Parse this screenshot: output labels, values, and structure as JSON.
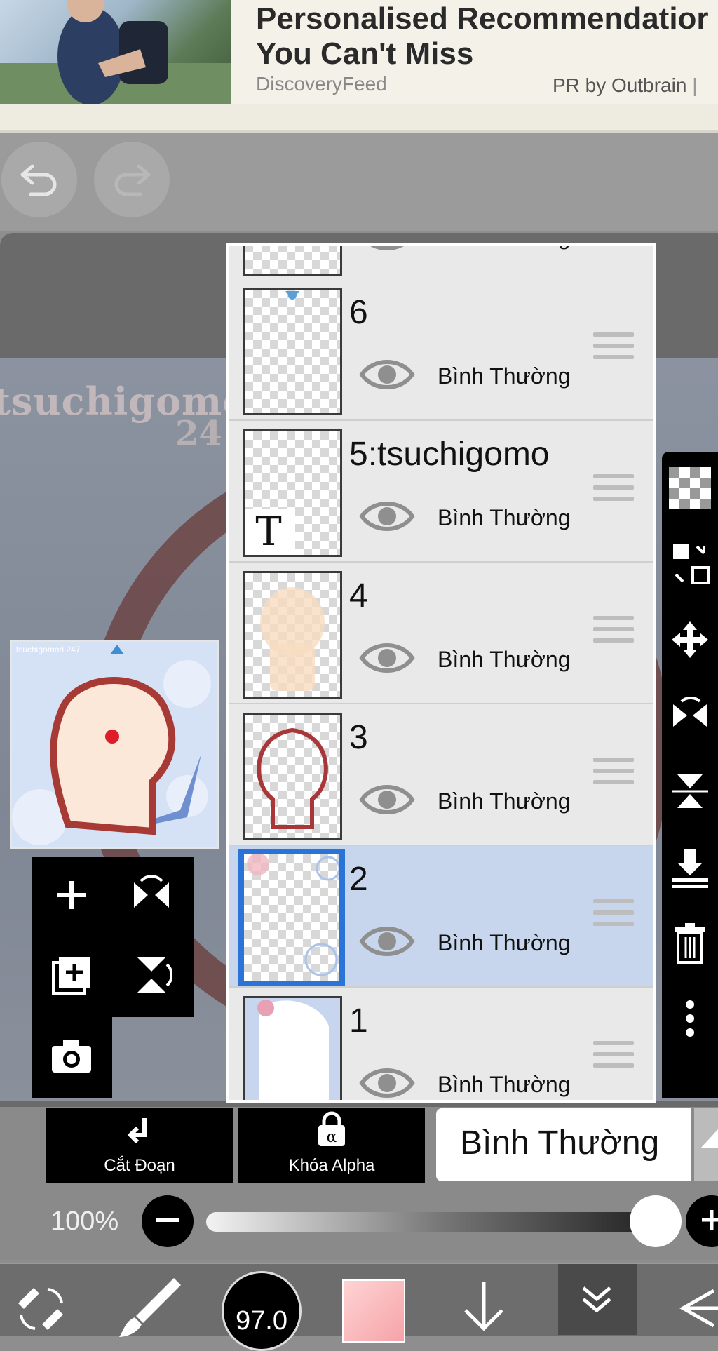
{
  "ad": {
    "title_line1": "Personalised Recommendatior",
    "title_line2": "You Can't Miss",
    "source": "DiscoveryFeed",
    "sponsor": "PR by Outbrain",
    "separator": "|"
  },
  "toolbar": {
    "undo_icon": "undo-icon",
    "redo_icon": "redo-icon"
  },
  "canvas": {
    "watermark_line1": "tsuchigomor",
    "watermark_line2": "24",
    "preview_caption": "tsuchigomori 247"
  },
  "layers": [
    {
      "id": "7",
      "name": "",
      "blend": "Bình Thường",
      "visible": true,
      "selected": false
    },
    {
      "id": "6",
      "name": "6",
      "blend": "Bình Thường",
      "visible": true,
      "selected": false
    },
    {
      "id": "5",
      "name": "5:tsuchigomo",
      "blend": "Bình Thường",
      "visible": true,
      "selected": false,
      "type_badge": "T"
    },
    {
      "id": "4",
      "name": "4",
      "blend": "Bình Thường",
      "visible": true,
      "selected": false
    },
    {
      "id": "3",
      "name": "3",
      "blend": "Bình Thường",
      "visible": true,
      "selected": false
    },
    {
      "id": "2",
      "name": "2",
      "blend": "Bình Thường",
      "visible": true,
      "selected": true
    },
    {
      "id": "1",
      "name": "1",
      "blend": "Bình Thường",
      "visible": true,
      "selected": false
    }
  ],
  "layer_modes": {
    "clip_label": "Cắt Đoạn",
    "alpha_lock_label": "Khóa Alpha",
    "blend_mode": "Bình Thường"
  },
  "opacity": {
    "label": "100%",
    "value": 1.0
  },
  "brush": {
    "size": "97.0"
  },
  "colors": {
    "selection_blue": "#2a74d8",
    "selected_row": "#c7d6ec",
    "primary_color": "#f5a3a8"
  }
}
